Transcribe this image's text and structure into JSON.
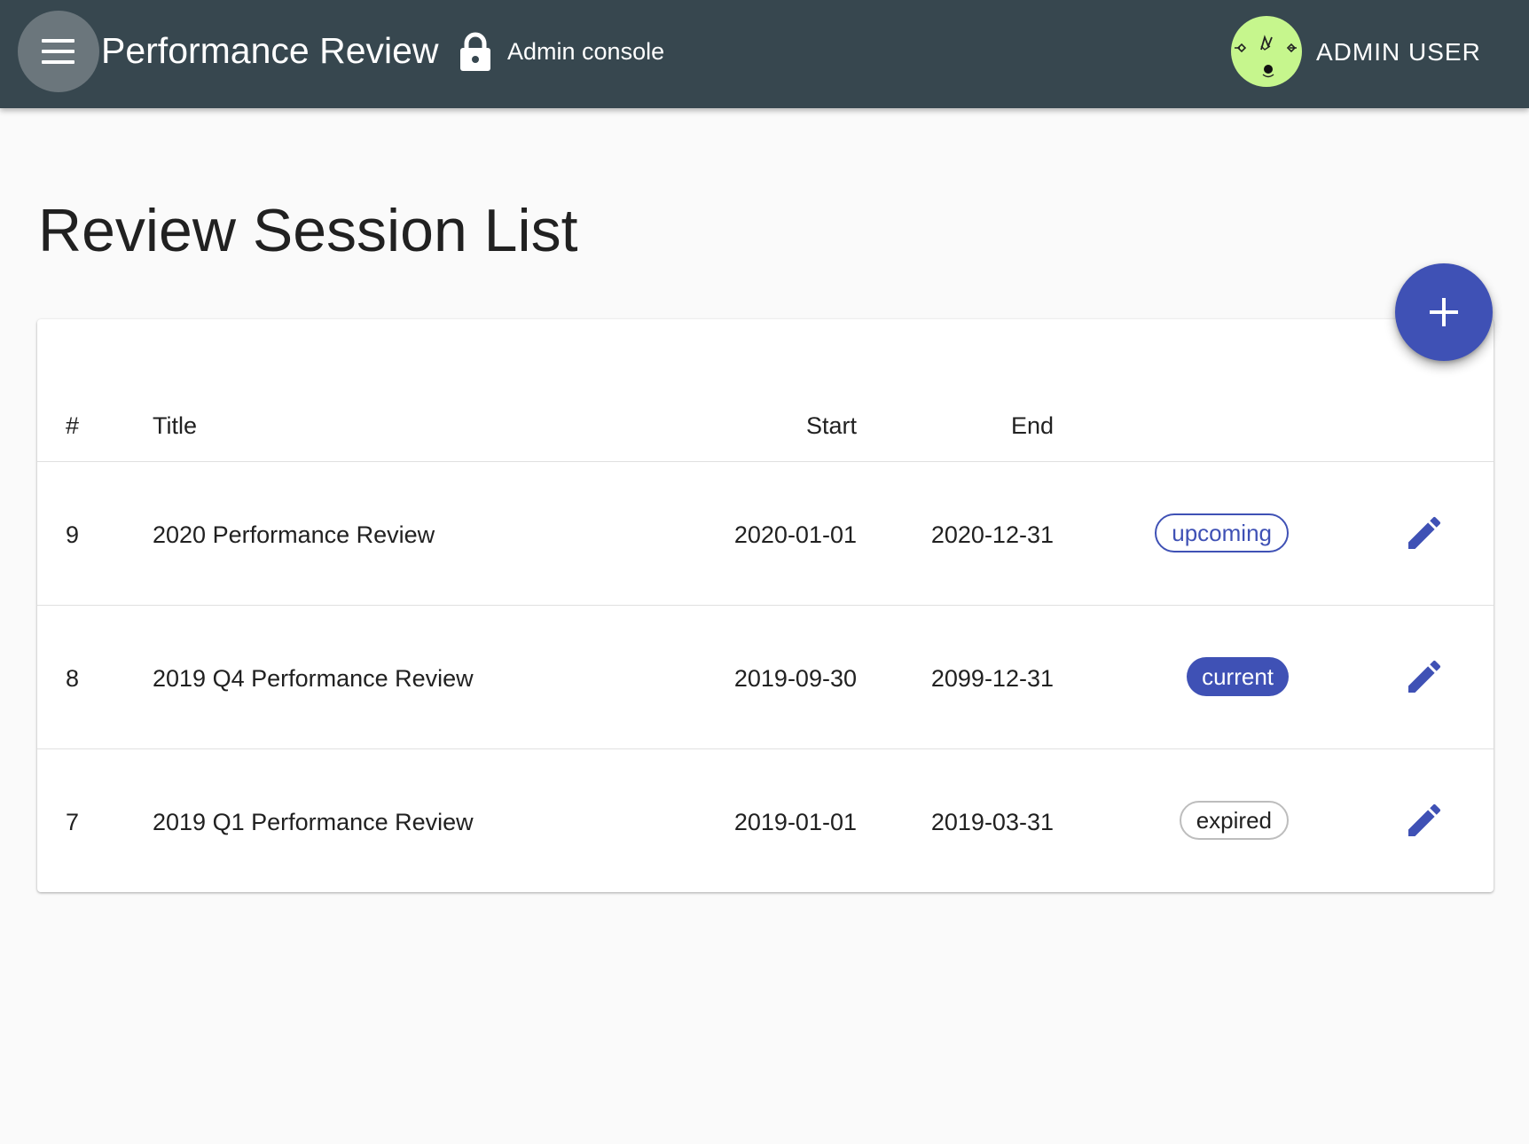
{
  "appbar": {
    "title": "Performance Review",
    "console_label": "Admin console",
    "user_name": "ADMIN USER",
    "icons": {
      "menu": "menu-icon",
      "lock": "lock-icon",
      "avatar": "avatar-face-icon"
    },
    "colors": {
      "background": "#37474f",
      "avatar_background": "#c6f68d"
    }
  },
  "page": {
    "title": "Review Session List"
  },
  "fab": {
    "icon": "plus-icon",
    "color": "#3f51b5"
  },
  "table": {
    "columns": [
      "#",
      "Title",
      "Start",
      "End"
    ],
    "rows": [
      {
        "id": "9",
        "title": "2020 Performance Review",
        "start": "2020-01-01",
        "end": "2020-12-31",
        "status": "upcoming"
      },
      {
        "id": "8",
        "title": "2019 Q4 Performance Review",
        "start": "2019-09-30",
        "end": "2099-12-31",
        "status": "current"
      },
      {
        "id": "7",
        "title": "2019 Q1 Performance Review",
        "start": "2019-01-01",
        "end": "2019-03-31",
        "status": "expired"
      }
    ],
    "edit_icon": "pencil-icon",
    "status_colors": {
      "upcoming": "#3f51b5",
      "current": "#3f51b5",
      "expired": "#bdbdbd"
    }
  }
}
